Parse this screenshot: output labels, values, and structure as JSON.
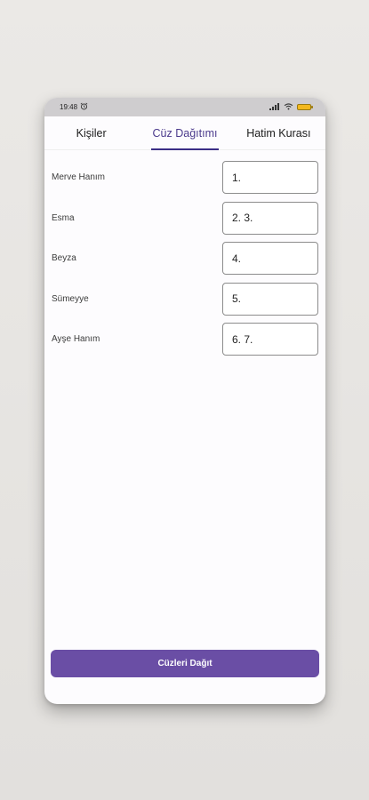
{
  "status_bar": {
    "time": "19:48",
    "icons": [
      "alarm-icon",
      "signal-icon",
      "wifi-icon",
      "battery-icon"
    ]
  },
  "tabs": [
    {
      "label": "Kişiler",
      "active": false
    },
    {
      "label": "Cüz Dağıtımı",
      "active": true
    },
    {
      "label": "Hatim Kurası",
      "active": false
    }
  ],
  "rows": [
    {
      "name": "Merve Hanım",
      "cuz": "1."
    },
    {
      "name": "Esma",
      "cuz": "2. 3."
    },
    {
      "name": "Beyza",
      "cuz": "4."
    },
    {
      "name": "Sümeyye",
      "cuz": "5."
    },
    {
      "name": "Ayşe Hanım",
      "cuz": "6. 7."
    }
  ],
  "action_button": {
    "label": "Cüzleri Dağıt"
  },
  "colors": {
    "accent": "#6a4ea5",
    "tab_indicator": "#3b2e86"
  }
}
